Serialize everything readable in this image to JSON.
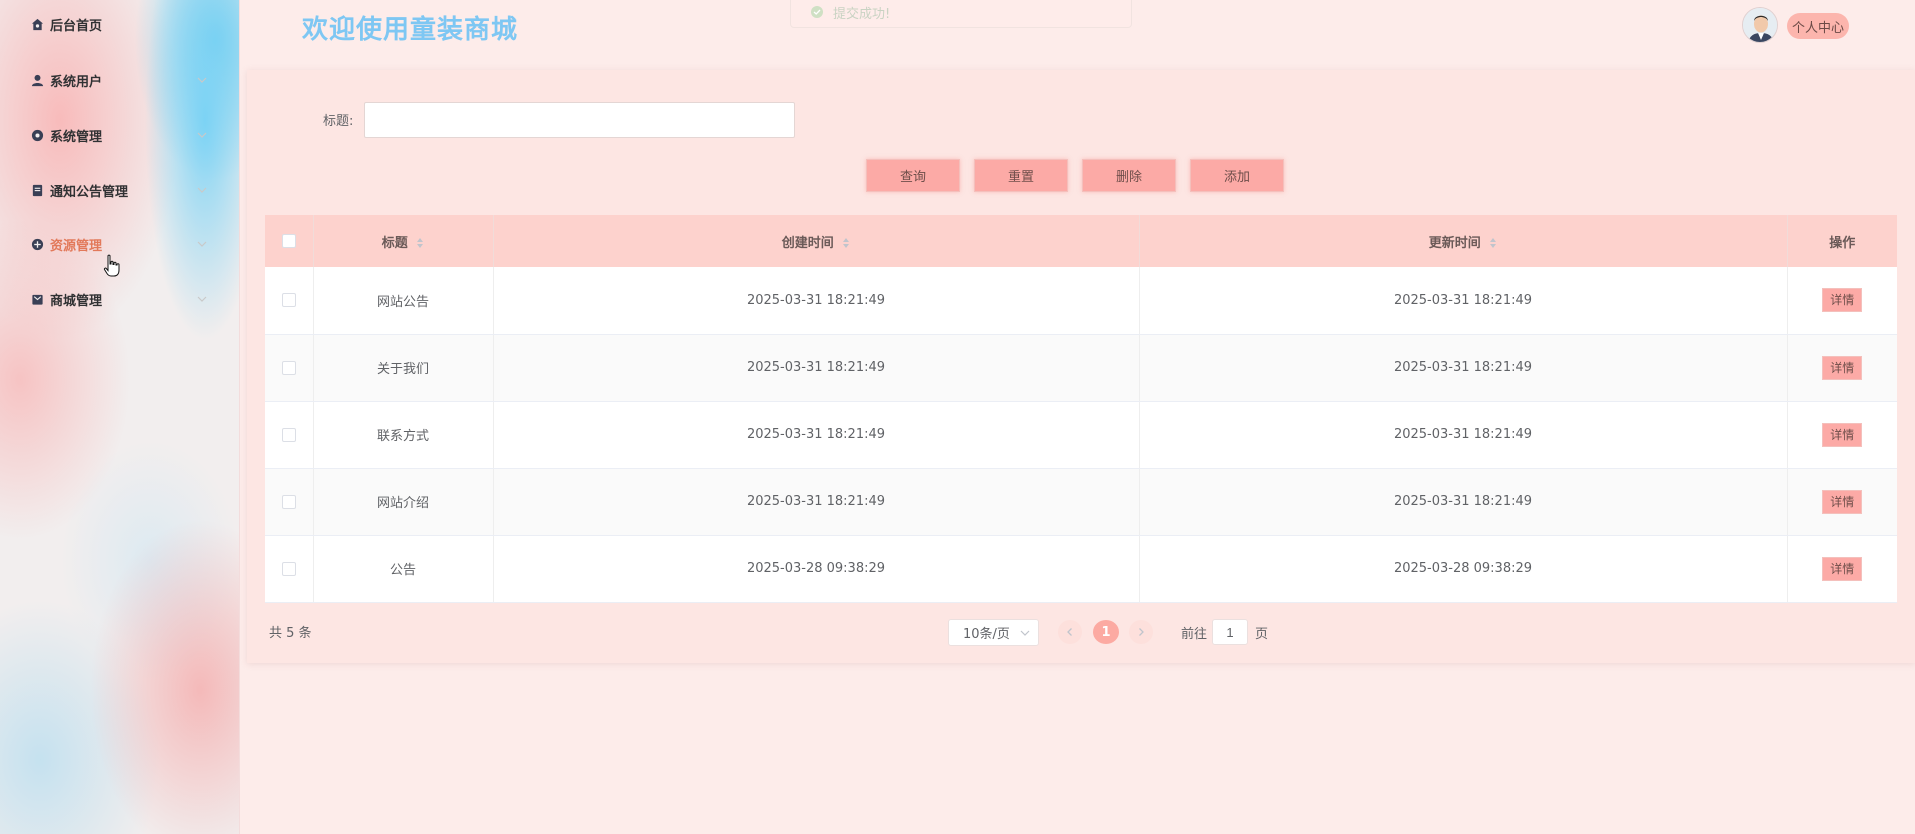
{
  "sidebar": {
    "items": [
      {
        "label": "后台首页",
        "icon": "home-icon",
        "has_arrow": false
      },
      {
        "label": "系统用户",
        "icon": "user-icon",
        "has_arrow": true
      },
      {
        "label": "系统管理",
        "icon": "gear-icon",
        "has_arrow": true
      },
      {
        "label": "通知公告管理",
        "icon": "document-icon",
        "has_arrow": true
      },
      {
        "label": "资源管理",
        "icon": "plus-circle-icon",
        "has_arrow": true,
        "active": true
      },
      {
        "label": "商城管理",
        "icon": "shop-icon",
        "has_arrow": true
      }
    ]
  },
  "header": {
    "title": "欢迎使用童装商城",
    "toast": "提交成功!",
    "user_center": "个人中心"
  },
  "search": {
    "title_label": "标题:",
    "title_value": ""
  },
  "toolbar": {
    "query": "查询",
    "reset": "重置",
    "delete": "删除",
    "add": "添加"
  },
  "table": {
    "headers": {
      "title": "标题",
      "created": "创建时间",
      "updated": "更新时间",
      "action": "操作"
    },
    "rows": [
      {
        "title": "网站公告",
        "created": "2025-03-31 18:21:49",
        "updated": "2025-03-31 18:21:49",
        "action": "详情"
      },
      {
        "title": "关于我们",
        "created": "2025-03-31 18:21:49",
        "updated": "2025-03-31 18:21:49",
        "action": "详情"
      },
      {
        "title": "联系方式",
        "created": "2025-03-31 18:21:49",
        "updated": "2025-03-31 18:21:49",
        "action": "详情"
      },
      {
        "title": "网站介绍",
        "created": "2025-03-31 18:21:49",
        "updated": "2025-03-31 18:21:49",
        "action": "详情"
      },
      {
        "title": "公告",
        "created": "2025-03-28 09:38:29",
        "updated": "2025-03-28 09:38:29",
        "action": "详情"
      }
    ]
  },
  "pagination": {
    "total": "共 5 条",
    "page_size": "10条/页",
    "current_page": "1",
    "goto_label": "前往",
    "goto_value": "1",
    "page_suffix": "页"
  },
  "colors": {
    "accent": "#fcaaa6",
    "title_blue": "#7ec7f3",
    "active_menu": "#e2795a",
    "header_row": "#fdd2cd"
  }
}
